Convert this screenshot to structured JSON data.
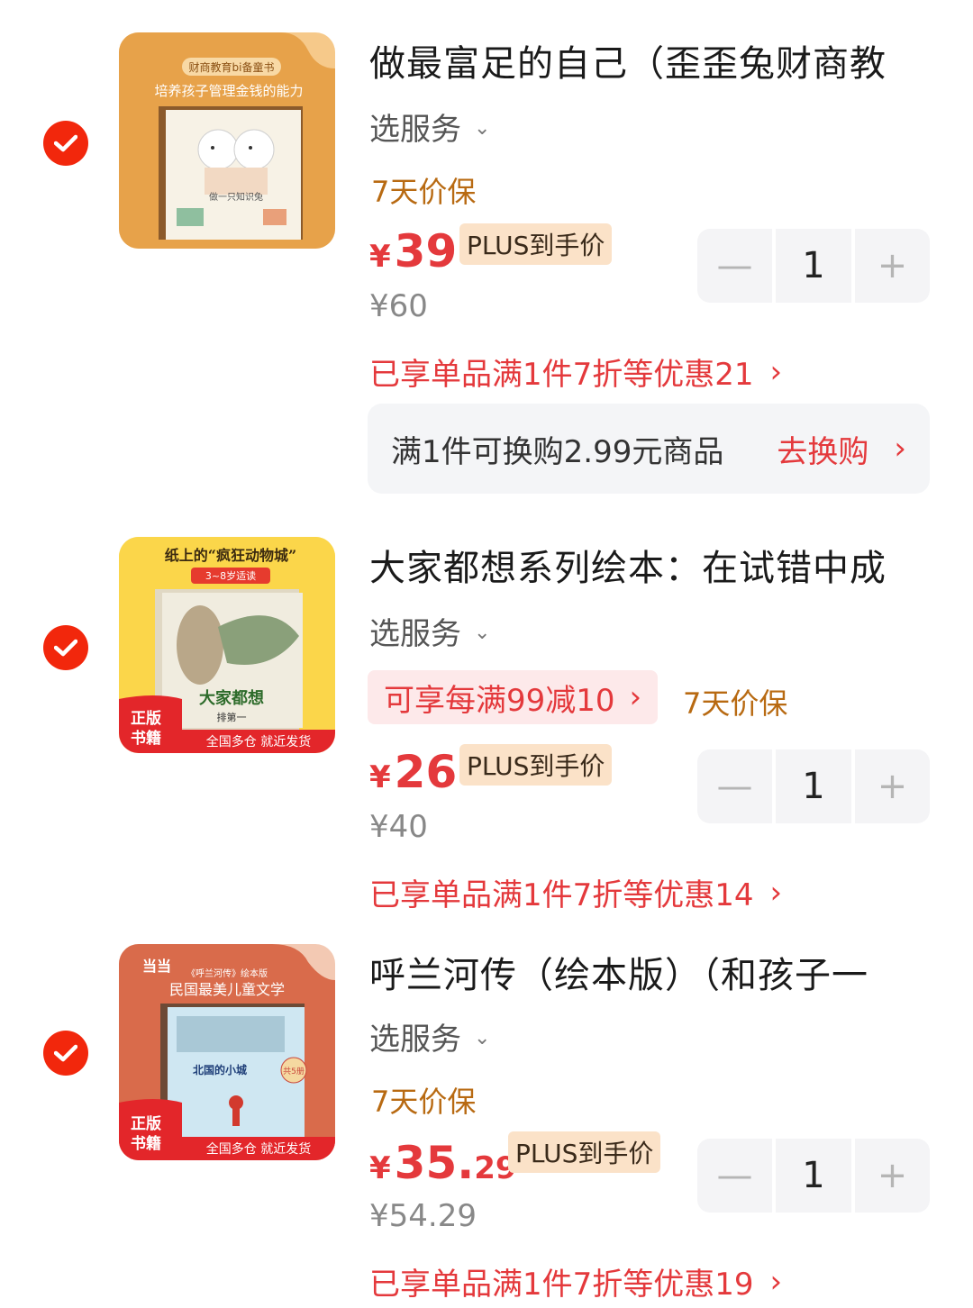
{
  "colors": {
    "accent": "#e4393c",
    "check": "#f2270c",
    "guarantee": "#b86a12",
    "plus_badge_bg": "#fbe2c8"
  },
  "items": [
    {
      "selected": true,
      "title": "做最富足的自己（歪歪兔财商教",
      "service": "选服务",
      "guarantee": "7天价保",
      "price_int": "39",
      "price_dec": "",
      "currency": "¥",
      "plus_badge": "PLUS到手价",
      "original_price": "¥60",
      "discount": "已享单品满1件7折等优惠21",
      "quantity": "1",
      "exchange_text": "满1件可换购2.99元商品",
      "exchange_link": "去换购",
      "cover_texts": [
        "财商教育bi备童书",
        "培养孩子管理金钱的能力",
        "做一只知识兔"
      ]
    },
    {
      "selected": true,
      "title": "大家都想系列绘本：在试错中成",
      "service": "选服务",
      "promo": "可享每满99减10",
      "guarantee": "7天价保",
      "price_int": "26",
      "price_dec": "",
      "currency": "¥",
      "plus_badge": "PLUS到手价",
      "original_price": "¥40",
      "discount": "已享单品满1件7折等优惠14",
      "quantity": "1",
      "cover_texts": [
        "纸上的“疯狂动物城”",
        "3~8岁适读",
        "大家都想",
        "排第一",
        "正版",
        "书籍",
        "全国多仓 就近发货"
      ]
    },
    {
      "selected": true,
      "title": "呼兰河传（绘本版）（和孩子一",
      "service": "选服务",
      "guarantee": "7天价保",
      "price_int": "35.",
      "price_dec": "29",
      "currency": "¥",
      "plus_badge": "PLUS到手价",
      "original_price": "¥54.29",
      "discount": "已享单品满1件7折等优惠19",
      "quantity": "1",
      "cover_texts": [
        "《呼兰河传》绘本版",
        "民国最美儿童文学",
        "北国的小城",
        "共5册",
        "正版",
        "书籍",
        "全国多仓 就近发货"
      ]
    }
  ]
}
